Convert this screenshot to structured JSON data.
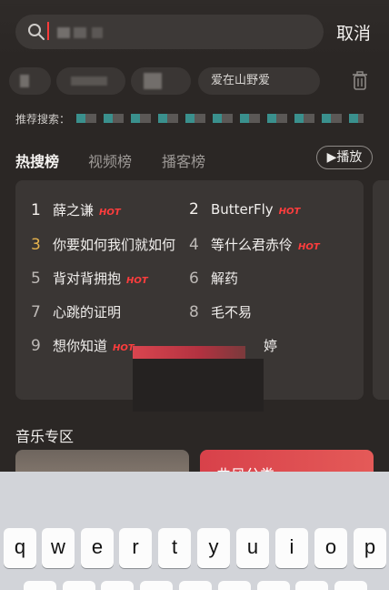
{
  "search": {
    "placeholder": "",
    "cancel_label": "取消"
  },
  "history": {
    "chips": [
      "",
      "",
      "",
      "爱在山野爱"
    ]
  },
  "recommend": {
    "label": "推荐搜索："
  },
  "tabs": [
    {
      "label": "热搜榜",
      "active": true
    },
    {
      "label": "视频榜",
      "active": false
    },
    {
      "label": "播客榜",
      "active": false
    }
  ],
  "play_label": "▶播放",
  "hot_list": [
    {
      "rank": "1",
      "title": "薛之谦",
      "hot": true
    },
    {
      "rank": "2",
      "title": "ButterFly",
      "hot": true
    },
    {
      "rank": "3",
      "title": "你要如何我们就如何",
      "hot": false
    },
    {
      "rank": "4",
      "title": "等什么君赤伶",
      "hot": true
    },
    {
      "rank": "5",
      "title": "背对背拥抱",
      "hot": true
    },
    {
      "rank": "6",
      "title": "解药",
      "hot": false
    },
    {
      "rank": "7",
      "title": "心跳的证明",
      "hot": false
    },
    {
      "rank": "8",
      "title": "毛不易",
      "hot": false
    },
    {
      "rank": "9",
      "title": "想你知道",
      "hot": true
    },
    {
      "rank": "",
      "title": "婷",
      "hot": false
    }
  ],
  "hot_badge": "HOT",
  "music_section": {
    "title": "音乐专区",
    "card2_label": "曲风分类"
  },
  "keyboard": {
    "row1": [
      "q",
      "w",
      "e",
      "r",
      "t",
      "y",
      "u",
      "i",
      "o",
      "p"
    ]
  },
  "colors": {
    "accent": "#ff3d3d",
    "background": "#2b2725",
    "card": "#3a3634"
  }
}
